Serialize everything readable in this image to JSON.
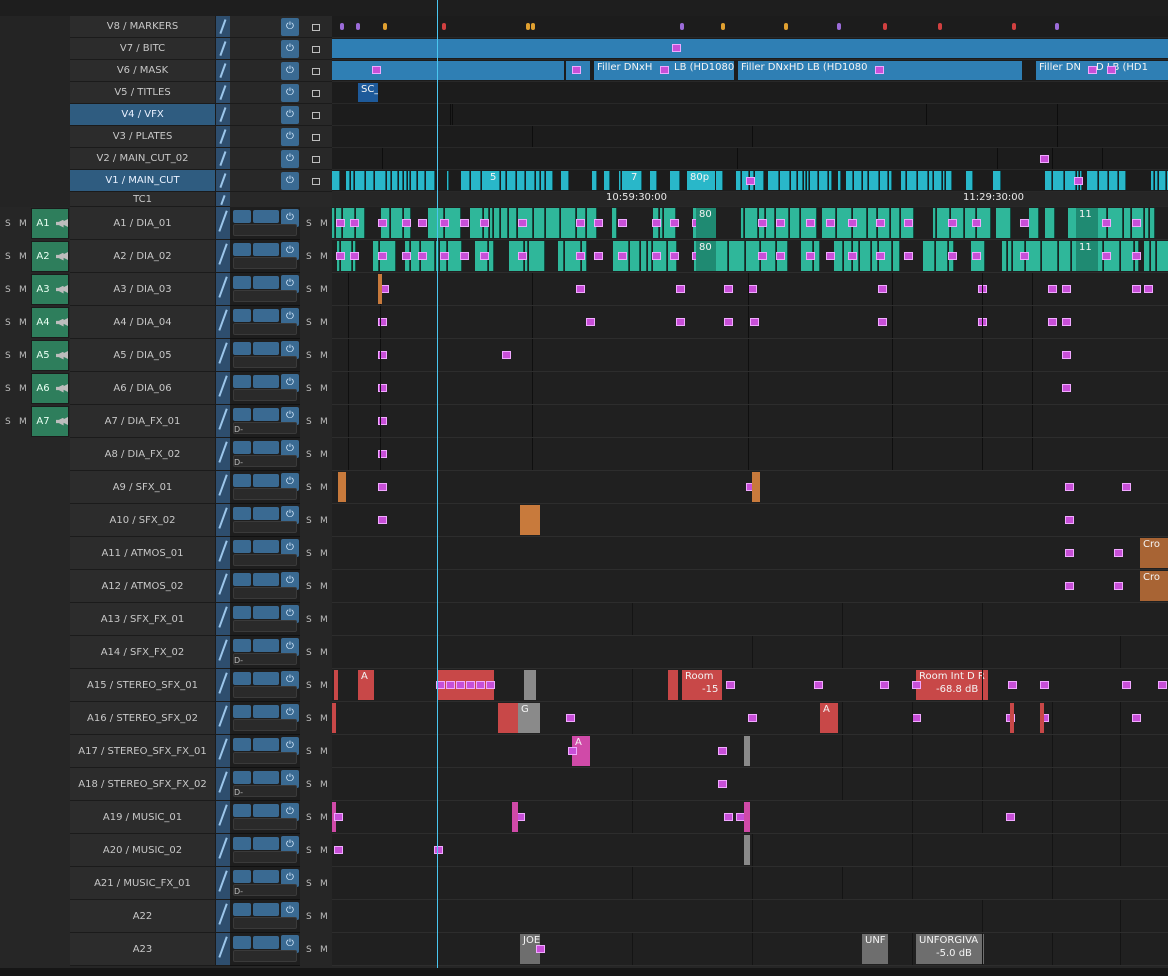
{
  "video_tracks": [
    {
      "label": "V8 / MARKERS",
      "selected": false
    },
    {
      "label": "V7 / BITC",
      "selected": false
    },
    {
      "label": "V6 / MASK",
      "selected": false
    },
    {
      "label": "V5 / TITLES",
      "selected": false
    },
    {
      "label": "V4 / VFX",
      "selected": true
    },
    {
      "label": "V3 / PLATES",
      "selected": false
    },
    {
      "label": "V2 / MAIN_CUT_02",
      "selected": false
    },
    {
      "label": "V1 / MAIN_CUT",
      "selected": true
    }
  ],
  "timecode_track": {
    "label": "TC1",
    "ticks": [
      {
        "text": "10:59:30:00"
      },
      {
        "text": "11:29:30:00"
      }
    ]
  },
  "audio_tracks": [
    {
      "label": "A1 / DIA_01",
      "button": "A1"
    },
    {
      "label": "A2 / DIA_02",
      "button": "A2"
    },
    {
      "label": "A3 / DIA_03",
      "button": "A3"
    },
    {
      "label": "A4 / DIA_04",
      "button": "A4"
    },
    {
      "label": "A5 / DIA_05",
      "button": "A5"
    },
    {
      "label": "A6 / DIA_06",
      "button": "A6"
    },
    {
      "label": "A7 / DIA_FX_01",
      "button": "A7"
    },
    {
      "label": "A8 / DIA_FX_02",
      "button": ""
    },
    {
      "label": "A9 / SFX_01",
      "button": ""
    },
    {
      "label": "A10 / SFX_02",
      "button": ""
    },
    {
      "label": "A11 / ATMOS_01",
      "button": ""
    },
    {
      "label": "A12 / ATMOS_02",
      "button": ""
    },
    {
      "label": "A13 / SFX_FX_01",
      "button": ""
    },
    {
      "label": "A14 / SFX_FX_02",
      "button": ""
    },
    {
      "label": "A15 / STEREO_SFX_01",
      "button": ""
    },
    {
      "label": "A16 / STEREO_SFX_02",
      "button": ""
    },
    {
      "label": "A17 / STEREO_SFX_FX_01",
      "button": ""
    },
    {
      "label": "A18 / STEREO_SFX_FX_02",
      "button": ""
    },
    {
      "label": "A19 / MUSIC_01",
      "button": ""
    },
    {
      "label": "A20 / MUSIC_02",
      "button": ""
    },
    {
      "label": "A21 / MUSIC_FX_01",
      "button": ""
    },
    {
      "label": "A22",
      "button": ""
    },
    {
      "label": "A23",
      "button": ""
    }
  ],
  "track_controls": {
    "solo": "S",
    "mute": "M",
    "d_label": "D-"
  },
  "clip_texts": {
    "v5_title": "SC_",
    "v6_filler_1": "Filler DNxH",
    "v6_filler_1b": "LB (HD1080",
    "v6_filler_2": "Filler DNxHD LB (HD1080",
    "v6_filler_3": "Filler DN",
    "v6_filler_3b": "D LB (HD1",
    "v1_5": "5",
    "v1_7": "7",
    "v1_80p": "80p",
    "a1_80": "80",
    "a1_11": "11",
    "a2_80": "80",
    "a2_11": "11",
    "a15_a": "A",
    "a15_room": "Room",
    "a15_room_gain": "-15",
    "a15_room_int": "Room Int D R",
    "a15_room_int_gain": "-68.8 dB",
    "a16_a": "A",
    "a16_g": "G",
    "a17_a": "A",
    "a11_cro": "Cro",
    "a12_cro": "Cro",
    "a23_joe": "JOE",
    "a23_unf": "UNF",
    "a23_unforgiv": "UNFORGIVA",
    "a23_gain": "-5.0 dB"
  },
  "colors": {
    "dialogue": "#2fb79a",
    "video_cut": "#29b7c9",
    "mask": "#2f7fb4",
    "sfx_orange": "#c87a3c",
    "stereo_red": "#c84848",
    "music_pink": "#d04aa8",
    "playhead": "#49c6f0",
    "marker_purple": "#c84fd8",
    "track_selected": "#2f5c80",
    "enable_green": "#2e7e5c"
  }
}
